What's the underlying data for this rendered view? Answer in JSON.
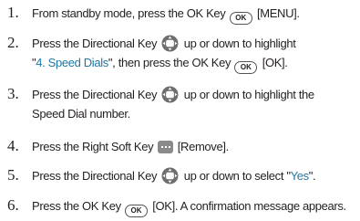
{
  "steps": [
    {
      "number": "1.",
      "lines": [
        {
          "pre": "From standby mode, press the OK Key",
          "key_label": "OK",
          "post": "[MENU]."
        }
      ]
    },
    {
      "number": "2.",
      "lines": [
        {
          "pre": "Press the Directional Key",
          "post": "up or down to highlight"
        },
        {
          "quote_open": "\"",
          "highlight": "4. Speed Dials",
          "quote_close": "\", then press the OK Key",
          "key_label": "OK",
          "post": "[OK]."
        }
      ]
    },
    {
      "number": "3.",
      "lines": [
        {
          "pre": "Press the Directional Key",
          "post": "up or down to highlight the"
        },
        {
          "text": "Speed Dial number."
        }
      ]
    },
    {
      "number": "4.",
      "lines": [
        {
          "pre": "Press the Right Soft Key",
          "post": "[Remove]."
        }
      ]
    },
    {
      "number": "5.",
      "lines": [
        {
          "pre": "Press the Directional Key",
          "mid": "up or down to select \"",
          "highlight": "Yes",
          "post": "\"."
        }
      ]
    },
    {
      "number": "6.",
      "lines": [
        {
          "pre": "Press the OK Key",
          "key_label": "OK",
          "post": "[OK]. A confirmation message appears."
        }
      ]
    }
  ],
  "colors": {
    "text": "#231f20",
    "highlight": "#1f78a4",
    "soft_key": "#8a8a8a"
  },
  "icons": {
    "ok_key": "ok-key-icon",
    "directional_key": "directional-key-icon",
    "right_soft_key": "right-soft-key-icon"
  }
}
